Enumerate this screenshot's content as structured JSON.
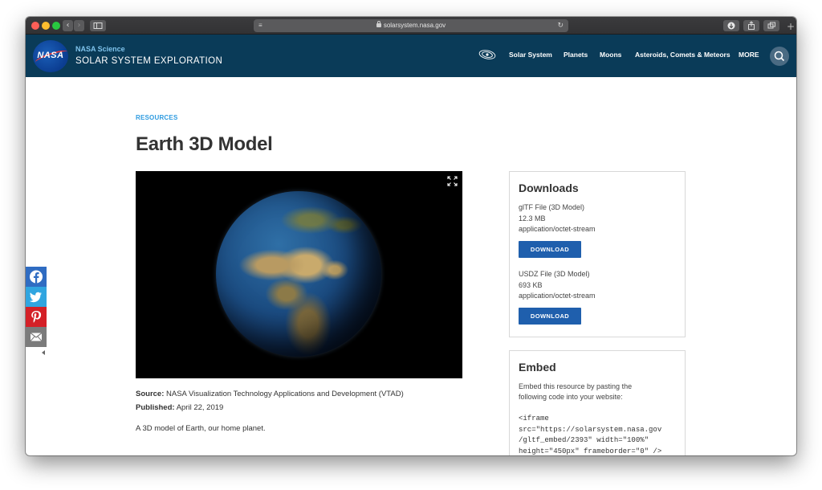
{
  "browser": {
    "url": "solarsystem.nasa.gov",
    "back_label": "‹",
    "forward_label": "›",
    "sidebar_icon": "sidebar-icon",
    "reader_icon": "reader-icon",
    "reload_icon": "reload-icon",
    "download_icon": "download-icon",
    "share_icon": "share-icon",
    "tabs_icon": "tabs-icon",
    "new_tab_label": "+"
  },
  "header": {
    "logo_text": "NASA",
    "brand_top": "NASA Science",
    "brand_main": "SOLAR SYSTEM EXPLORATION",
    "nav": [
      "Solar System",
      "Planets",
      "Moons",
      "Asteroids, Comets & Meteors",
      "MORE"
    ],
    "colors": {
      "bg": "#0a3b58",
      "accent": "#7fc3ec"
    }
  },
  "page": {
    "eyebrow": "RESOURCES",
    "title": "Earth 3D Model",
    "source_label": "Source:",
    "source_value": "NASA Visualization Technology Applications and Development (VTAD)",
    "published_label": "Published:",
    "published_value": "April 22, 2019",
    "description": "A 3D model of Earth, our home planet."
  },
  "downloads": {
    "title": "Downloads",
    "files": [
      {
        "name": "glTF File (3D Model)",
        "size": "12.3 MB",
        "type": "application/octet-stream",
        "button": "DOWNLOAD"
      },
      {
        "name": "USDZ File (3D Model)",
        "size": "693 KB",
        "type": "application/octet-stream",
        "button": "DOWNLOAD"
      }
    ]
  },
  "embed": {
    "title": "Embed",
    "intro_1": "Embed this resource by pasting the",
    "intro_2": "following code into your website:",
    "code": "<iframe\nsrc=\"https://solarsystem.nasa.gov\n/gltf_embed/2393\" width=\"100%\"\nheight=\"450px\" frameborder=\"0\" />"
  },
  "share": [
    "facebook-icon",
    "twitter-icon",
    "pinterest-icon",
    "email-icon"
  ]
}
